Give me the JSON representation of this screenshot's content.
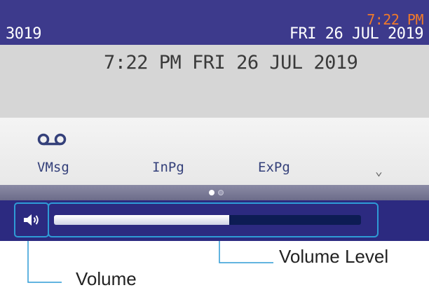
{
  "status_bar": {
    "extension": "3019",
    "time": "7:22 PM",
    "date": "FRI 26 JUL 2019"
  },
  "datetime_display": "7:22 PM FRI 26 JUL 2019",
  "softkeys": [
    {
      "label": "VMsg",
      "icon": "voicemail-icon"
    },
    {
      "label": "InPg"
    },
    {
      "label": "ExPg"
    }
  ],
  "more_indicator": "⌄",
  "page_indicator": {
    "pages": 2,
    "current": 1
  },
  "volume": {
    "icon": "speaker-icon",
    "level": 0.57
  },
  "callouts": {
    "volume_level": "Volume Level",
    "volume": "Volume"
  },
  "colors": {
    "status_bar": "#3d3a8c",
    "time_accent": "#f07a2a",
    "volume_bar": "#2c2a80",
    "callout_outline": "#2e9bd6"
  }
}
